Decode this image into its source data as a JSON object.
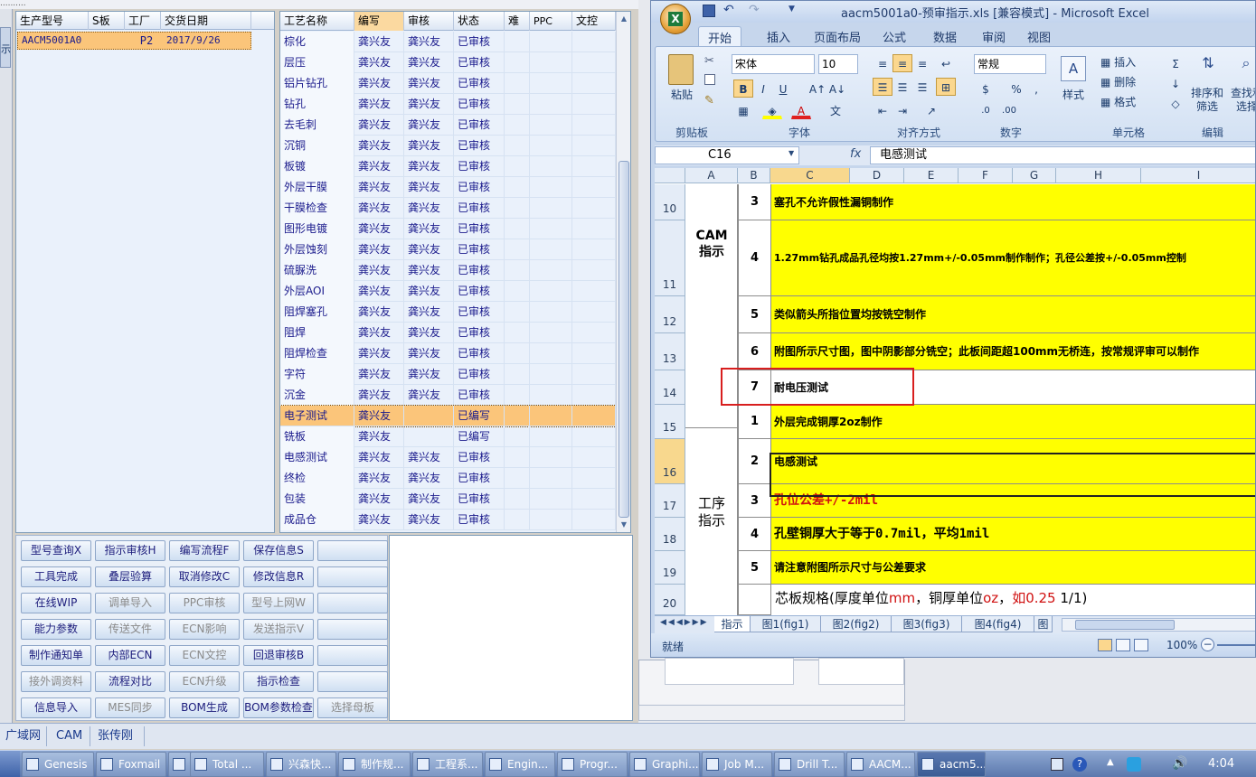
{
  "top_menu": "..........",
  "left_strip": "示",
  "order_grid": {
    "headers": [
      "生产型号",
      "S板",
      "工厂",
      "交货日期"
    ],
    "rows": [
      [
        "AACM5001A0",
        "",
        "P2",
        "2017/9/26"
      ]
    ]
  },
  "process_grid": {
    "headers": [
      "工艺名称",
      "编写",
      "审核",
      "状态",
      "难",
      "PPC",
      "文控"
    ],
    "rows": [
      [
        "棕化",
        "龚兴友",
        "龚兴友",
        "已审核"
      ],
      [
        "层压",
        "龚兴友",
        "龚兴友",
        "已审核"
      ],
      [
        "铝片钻孔",
        "龚兴友",
        "龚兴友",
        "已审核"
      ],
      [
        "钻孔",
        "龚兴友",
        "龚兴友",
        "已审核"
      ],
      [
        "去毛刺",
        "龚兴友",
        "龚兴友",
        "已审核"
      ],
      [
        "沉铜",
        "龚兴友",
        "龚兴友",
        "已审核"
      ],
      [
        "板镀",
        "龚兴友",
        "龚兴友",
        "已审核"
      ],
      [
        "外层干膜",
        "龚兴友",
        "龚兴友",
        "已审核"
      ],
      [
        "干膜检查",
        "龚兴友",
        "龚兴友",
        "已审核"
      ],
      [
        "图形电镀",
        "龚兴友",
        "龚兴友",
        "已审核"
      ],
      [
        "外层蚀刻",
        "龚兴友",
        "龚兴友",
        "已审核"
      ],
      [
        "硫脲洗",
        "龚兴友",
        "龚兴友",
        "已审核"
      ],
      [
        "外层AOI",
        "龚兴友",
        "龚兴友",
        "已审核"
      ],
      [
        "阻焊塞孔",
        "龚兴友",
        "龚兴友",
        "已审核"
      ],
      [
        "阻焊",
        "龚兴友",
        "龚兴友",
        "已审核"
      ],
      [
        "阻焊检查",
        "龚兴友",
        "龚兴友",
        "已审核"
      ],
      [
        "字符",
        "龚兴友",
        "龚兴友",
        "已审核"
      ],
      [
        "沉金",
        "龚兴友",
        "龚兴友",
        "已审核"
      ],
      [
        "电子测试",
        "龚兴友",
        "",
        "已编写"
      ],
      [
        "铣板",
        "龚兴友",
        "",
        "已编写"
      ],
      [
        "电感测试",
        "龚兴友",
        "龚兴友",
        "已审核"
      ],
      [
        "终检",
        "龚兴友",
        "龚兴友",
        "已审核"
      ],
      [
        "包装",
        "龚兴友",
        "龚兴友",
        "已审核"
      ],
      [
        "成品仓",
        "龚兴友",
        "龚兴友",
        "已审核"
      ]
    ],
    "selected_row": 18
  },
  "buttons": [
    [
      "型号查询X",
      "指示审核H",
      "编写流程F",
      "保存信息S",
      ""
    ],
    [
      "工具完成",
      "叠层验算",
      "取消修改C",
      "修改信息R",
      ""
    ],
    [
      "在线WIP",
      "调单导入",
      "PPC审核",
      "型号上网W",
      ""
    ],
    [
      "能力参数",
      "传送文件",
      "ECN影响",
      "发送指示V",
      ""
    ],
    [
      "制作通知单",
      "内部ECN",
      "ECN文控",
      "回退审核B",
      ""
    ],
    [
      "接外调资料",
      "流程对比",
      "ECN升级",
      "指示检查",
      ""
    ],
    [
      "信息导入",
      "MES同步",
      "BOM生成",
      "BOM参数检查",
      "选择母板"
    ]
  ],
  "buttons_disabled": [
    [
      2,
      1
    ],
    [
      2,
      2
    ],
    [
      2,
      3
    ],
    [
      3,
      1
    ],
    [
      3,
      2
    ],
    [
      3,
      3
    ],
    [
      4,
      2
    ],
    [
      5,
      0
    ],
    [
      5,
      2
    ],
    [
      6,
      1
    ],
    [
      6,
      4
    ]
  ],
  "status_bar": [
    "广域网",
    "CAM",
    "张传刚"
  ],
  "excel": {
    "title": "aacm5001a0-预审指示.xls  [兼容模式] - Microsoft Excel",
    "tabs": [
      "开始",
      "插入",
      "页面布局",
      "公式",
      "数据",
      "审阅",
      "视图"
    ],
    "font_name": "宋体",
    "font_size": "10",
    "number_format": "常规",
    "paste_label": "粘贴",
    "style_label": "样式",
    "insert_label": "插入",
    "delete_label": "删除",
    "format_label": "格式",
    "sort_label": "排序和\n筛选",
    "find_label": "查找和\n选择",
    "groups": [
      "剪贴板",
      "字体",
      "对齐方式",
      "数字",
      "单元格",
      "编辑"
    ],
    "name_box": "C16",
    "formula": "电感测试",
    "fx": "fx",
    "columns": [
      "A",
      "B",
      "C",
      "D",
      "E",
      "F",
      "G",
      "H",
      "I"
    ],
    "rows": [
      {
        "num": "10",
        "b": "3",
        "c": "塞孔不允许假性漏铜制作",
        "red": ""
      },
      {
        "num": "11",
        "b": "4",
        "c": "1.27mm钻孔成品孔径均按1.27mm+/-0.05mm制作制作；孔径公差按+/-0.05mm控制",
        "red": ""
      },
      {
        "num": "12",
        "b": "5",
        "c": "类似箭头所指位置均按铣空制作",
        "red": ""
      },
      {
        "num": "13",
        "b": "6",
        "c": "附图所示尺寸图，图中阴影部分铣空；此板间距超100mm无桥连，按常规评审可以制作",
        "red": ""
      },
      {
        "num": "14",
        "b": "7",
        "c": "耐电压测试",
        "red": ""
      },
      {
        "num": "15",
        "b": "1",
        "c": "外层完成铜厚2oz制作",
        "red": ""
      },
      {
        "num": "16",
        "b": "2",
        "c": "电感测试",
        "red": ""
      },
      {
        "num": "17",
        "b": "3",
        "c": "孔位公差+/-2mil",
        "red": "true"
      },
      {
        "num": "18",
        "b": "4",
        "c": "孔壁铜厚大于等于0.7mil，平均1mil",
        "red": ""
      },
      {
        "num": "19",
        "b": "5",
        "c": "请注意附图所示尺寸与公差要求",
        "red": ""
      },
      {
        "num": "20",
        "b": "",
        "c": "芯板规格(厚度单位mm，铜厚单位oz，如0.25 1/1)",
        "red": ""
      }
    ],
    "cam_label": "CAM\n指示",
    "process_label": "工序\n指示",
    "row20_parts": [
      "芯板规格(厚度单位",
      "mm",
      "，铜厚单位",
      "oz",
      "，如0.25 1/1)"
    ],
    "sheet_tabs": [
      "指示",
      "图1(fig1)",
      "图2(fig2)",
      "图3(fig3)",
      "图4(fig4)",
      "图"
    ],
    "status": "就绪",
    "zoom": "100%"
  },
  "taskbar": {
    "items": [
      "Genesis",
      "Foxmail",
      "",
      "Total ...",
      "兴森快...",
      "制作规...",
      "工程系...",
      "Engin...",
      "Progr...",
      "Graphi...",
      "Job M...",
      "Drill T...",
      "AACM...",
      "aacm5..."
    ],
    "time": "4:04"
  },
  "colors": {
    "highlight": "#fbc57a",
    "grid_text": "#1a1a8c",
    "yellow": "#ffff00",
    "red_box": "#d81e1e"
  }
}
